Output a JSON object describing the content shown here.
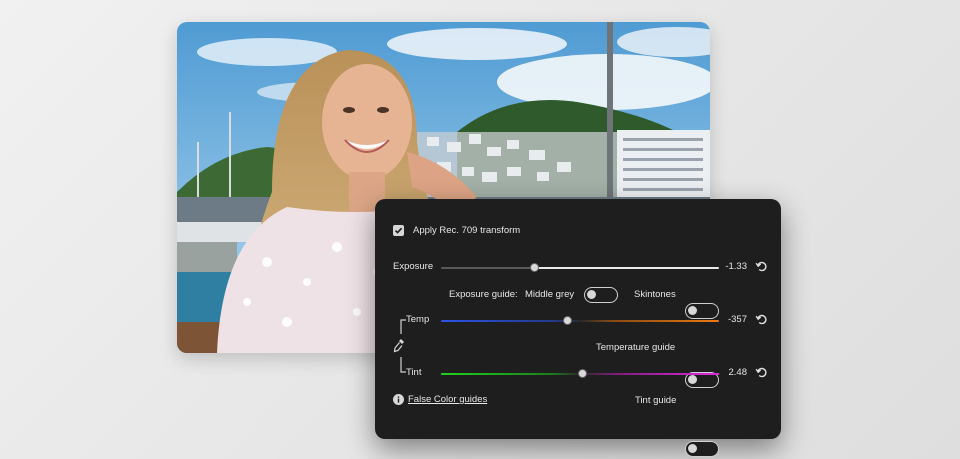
{
  "panel": {
    "apply_transform": {
      "label": "Apply Rec. 709 transform",
      "checked": true
    },
    "exposure": {
      "label": "Exposure",
      "value": "-1.33"
    },
    "exposure_guide": {
      "label": "Exposure guide:",
      "middle_grey_label": "Middle grey",
      "middle_grey_on": false,
      "skintones_label": "Skintones",
      "skintones_on": false
    },
    "temp": {
      "label": "Temp",
      "value": "-357"
    },
    "temperature_guide": {
      "label": "Temperature guide",
      "on": false
    },
    "tint": {
      "label": "Tint",
      "value": "2.48"
    },
    "false_color": {
      "label": "False Color guides"
    },
    "tint_guide": {
      "label": "Tint guide",
      "on": false
    }
  },
  "icons": {
    "checkbox": "checkmark-icon",
    "reset": "reset-icon",
    "eyedropper": "eyedropper-icon",
    "info": "info-icon"
  },
  "colors": {
    "panel_bg": "#1e1e1f",
    "temp_blue": "#2a54e6",
    "temp_orange": "#ee7a12",
    "tint_green": "#21d421",
    "tint_magenta": "#e229e2"
  }
}
